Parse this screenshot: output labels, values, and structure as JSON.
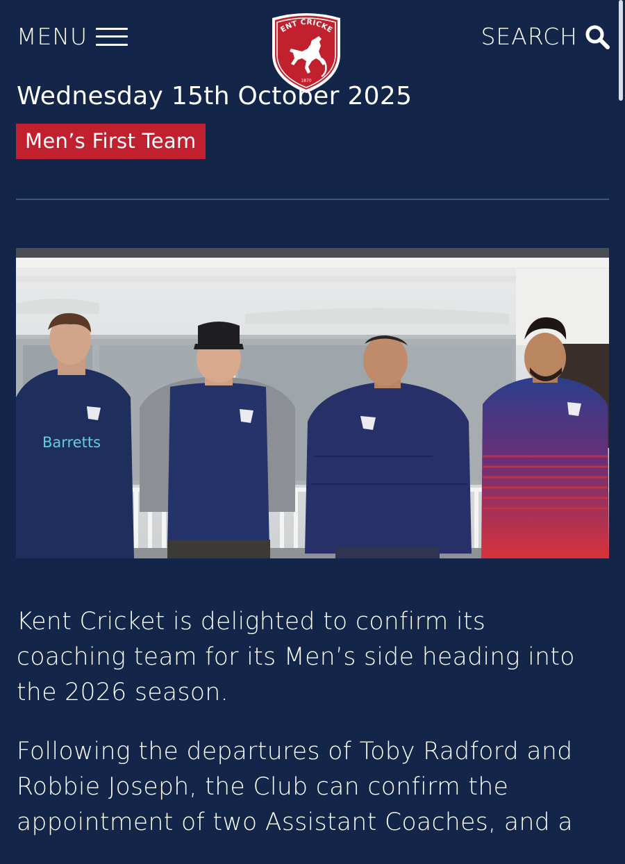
{
  "header": {
    "menu_label": "MENU",
    "search_label": "SEARCH",
    "logo": {
      "name": "Kent Cricket crest",
      "text_top": "KENT CRICKET",
      "text_bottom": "1870",
      "colors": {
        "shield": "#c1202e",
        "border": "#ffffff"
      }
    }
  },
  "article": {
    "date": "Wednesday 15th October 2025",
    "category": "Men’s First Team",
    "image": {
      "description_people_count": 4,
      "shirt_text": "Barretts"
    },
    "paragraphs": [
      "Kent Cricket is delighted to confirm its coaching team for its Men’s side heading into the 2026 season.",
      "Following the departures of Toby Radford and Robbie Joseph, the Club can confirm the appointment of two Assistant Coaches, and a"
    ]
  },
  "colors": {
    "background": "#13264a",
    "accent": "#c1202e",
    "divider": "#3e557f"
  }
}
